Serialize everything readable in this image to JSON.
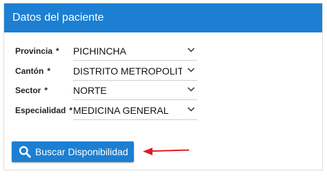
{
  "card": {
    "title": "Datos del paciente"
  },
  "fields": [
    {
      "label": "Provincia",
      "required_mark": "*",
      "value": "PICHINCHA"
    },
    {
      "label": "Cantón",
      "required_mark": "*",
      "value": "DISTRITO METROPOLIT. D"
    },
    {
      "label": "Sector",
      "required_mark": "*",
      "value": "NORTE"
    },
    {
      "label": "Especialidad",
      "required_mark": "*",
      "value": "MEDICINA GENERAL"
    }
  ],
  "search_button": {
    "label": "Buscar Disponibilidad",
    "icon": "search-icon"
  },
  "annotation": {
    "icon": "red-arrow-icon",
    "color": "#e01b22"
  },
  "colors": {
    "primary": "#1c7fd2",
    "text": "#222222"
  }
}
